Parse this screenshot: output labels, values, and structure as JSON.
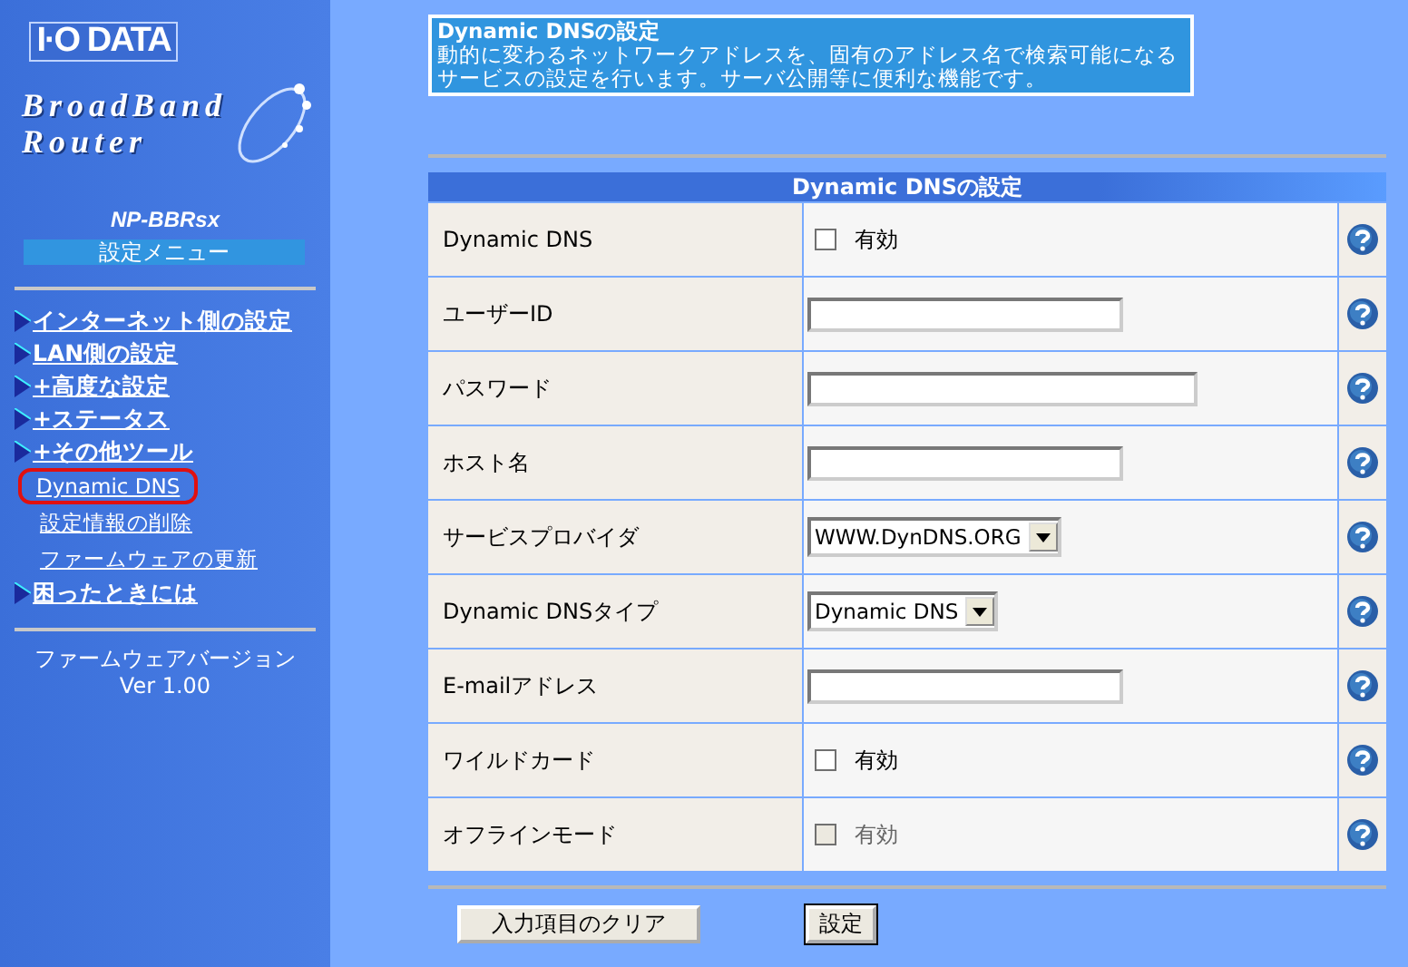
{
  "sidebar": {
    "brand": "I·O DATA",
    "product_line_1": "BroadBand",
    "product_line_2": "Router",
    "model": "NP-BBRsx",
    "menu_title": "設定メニュー",
    "items": [
      {
        "label": "インターネット側の設定",
        "kind": "main"
      },
      {
        "label": "LAN側の設定",
        "kind": "main"
      },
      {
        "label": "+高度な設定",
        "kind": "main"
      },
      {
        "label": "+ステータス",
        "kind": "main"
      },
      {
        "label": "+その他ツール",
        "kind": "main"
      },
      {
        "label": "Dynamic DNS",
        "kind": "sub",
        "selected": true
      },
      {
        "label": "設定情報の削除",
        "kind": "sub",
        "selected": false
      },
      {
        "label": "ファームウェアの更新",
        "kind": "sub",
        "selected": false
      },
      {
        "label": "困ったときには",
        "kind": "main"
      }
    ],
    "firmware_label": "ファームウェアバージョン",
    "firmware_version": "Ver 1.00"
  },
  "info_box": {
    "title": "Dynamic DNSの設定",
    "description": "動的に変わるネットワークアドレスを、固有のアドレス名で検索可能になるサービスの設定を行います。サーバ公開等に便利な機能です。"
  },
  "table": {
    "title": "Dynamic DNSの設定",
    "rows": [
      {
        "label": "Dynamic DNS",
        "kind": "checkbox",
        "checked": false,
        "disabled": false,
        "option": "有効"
      },
      {
        "label": "ユーザーID",
        "kind": "text"
      },
      {
        "label": "パスワード",
        "kind": "password"
      },
      {
        "label": "ホスト名",
        "kind": "text"
      },
      {
        "label": "サービスプロバイダ",
        "kind": "select",
        "value": "WWW.DynDNS.ORG"
      },
      {
        "label": "Dynamic DNSタイプ",
        "kind": "select",
        "value": "Dynamic DNS"
      },
      {
        "label": "E-mailアドレス",
        "kind": "text"
      },
      {
        "label": "ワイルドカード",
        "kind": "checkbox",
        "checked": false,
        "disabled": false,
        "option": "有効"
      },
      {
        "label": "オフラインモード",
        "kind": "checkbox",
        "checked": false,
        "disabled": true,
        "option": "有効"
      }
    ]
  },
  "buttons": [
    {
      "label": "入力項目のクリア",
      "kind": "wide"
    },
    {
      "label": "設定",
      "kind": "small"
    }
  ]
}
